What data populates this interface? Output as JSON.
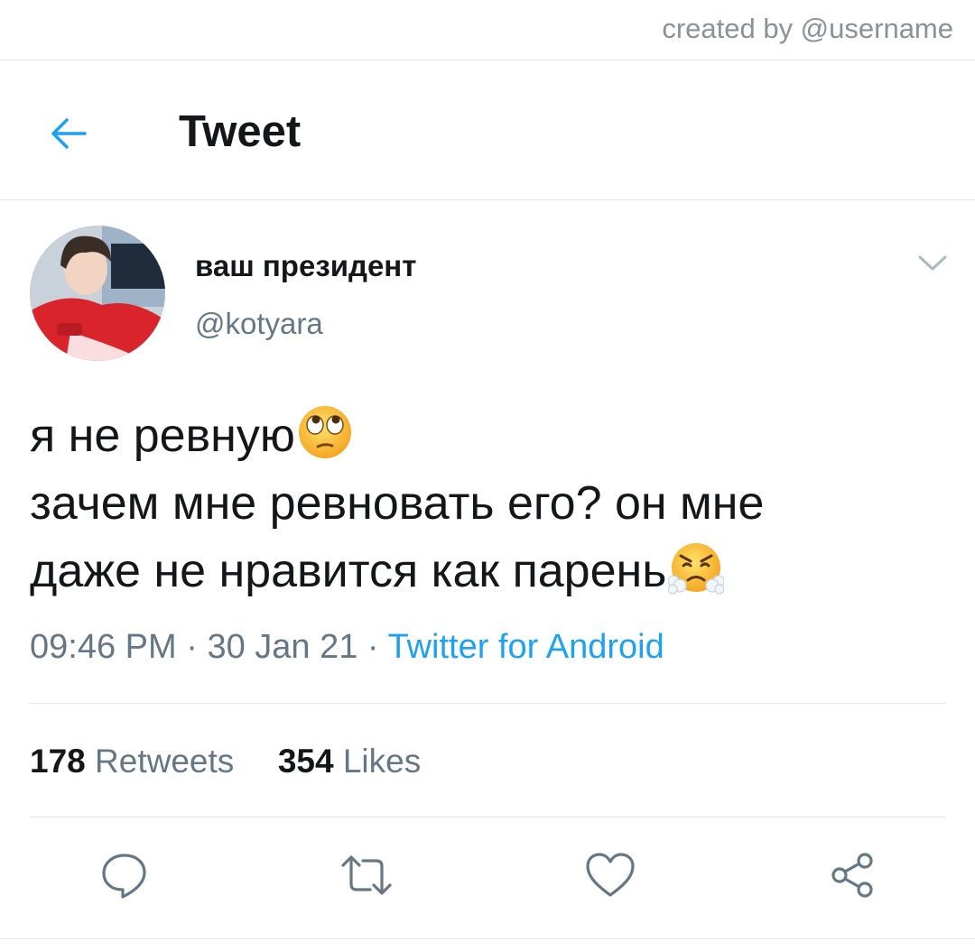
{
  "watermark": "created by @username",
  "header": {
    "title": "Tweet"
  },
  "tweet": {
    "display_name": "ваш президент",
    "handle": "@kotyara",
    "text_line1": "я не ревную",
    "text_line2": "зачем мне ревновать его? он мне",
    "text_line3": "даже не нравится как парень",
    "time": "09:46 PM",
    "date": "30 Jan 21",
    "separator": " · ",
    "source": "Twitter for Android",
    "retweets_count": "178",
    "retweets_label": "Retweets",
    "likes_count": "354",
    "likes_label": "Likes"
  },
  "icons": {
    "back": "arrow-left-icon",
    "menu": "chevron-down-icon",
    "reply": "reply-icon",
    "retweet": "retweet-icon",
    "like": "heart-icon",
    "share": "share-icon",
    "emoji1": "face-with-rolling-eyes",
    "emoji2": "face-with-steam-from-nose"
  },
  "colors": {
    "accent": "#1da1f2",
    "text": "#14171a",
    "muted": "#657786",
    "divider": "#e1e8ed"
  }
}
